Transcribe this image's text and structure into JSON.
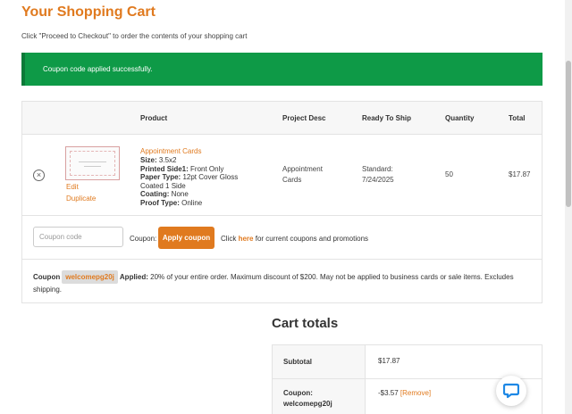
{
  "header": {
    "title": "Your Shopping Cart",
    "subtitle": "Click \"Proceed to Checkout\" to order the contents of your shopping cart"
  },
  "notice": {
    "message": "Coupon code applied successfully.",
    "color": "#0e9a47"
  },
  "cart": {
    "columns": [
      "Product",
      "Project Desc",
      "Ready To Ship",
      "Quantity",
      "Total"
    ],
    "item": {
      "name": "Appointment Cards",
      "edit_label": "Edit",
      "duplicate_label": "Duplicate",
      "remove_icon": "circle-x-icon",
      "specs": [
        {
          "label": "Size:",
          "value": "3.5x2"
        },
        {
          "label": "Printed Side1:",
          "value": "Front Only"
        },
        {
          "label": "Paper Type:",
          "value": "12pt Cover Gloss Coated 1 Side"
        },
        {
          "label": "Coating:",
          "value": "None"
        },
        {
          "label": "Proof Type:",
          "value": "Online"
        }
      ],
      "project_desc": "Appointment Cards",
      "ready_to_ship": "Standard: 7/24/2025",
      "quantity": "50",
      "total": "$17.87"
    }
  },
  "coupon": {
    "input_placeholder": "Coupon code",
    "label": "Coupon:",
    "apply_label": "Apply coupon",
    "click_prefix": "Click",
    "here_link": "here",
    "click_suffix": "for current coupons and promotions",
    "applied_prefix": "Coupon",
    "code": "welcomepg20j",
    "applied_word": "Applied:",
    "applied_desc": "20% of your entire order. Maximum discount of $200. May not be applied to business cards or sale items. Excludes shipping."
  },
  "totals": {
    "title": "Cart totals",
    "subtotal_label": "Subtotal",
    "subtotal_value": "$17.87",
    "coupon_label": "Coupon: welcomepg20j",
    "coupon_value": "-$3.57",
    "remove_label": "[Remove]"
  },
  "colors": {
    "accent": "#e07a1f",
    "success": "#0e9a47",
    "chat_icon": "#1e88e5"
  },
  "chat": {
    "icon": "chat-bubble-icon"
  }
}
